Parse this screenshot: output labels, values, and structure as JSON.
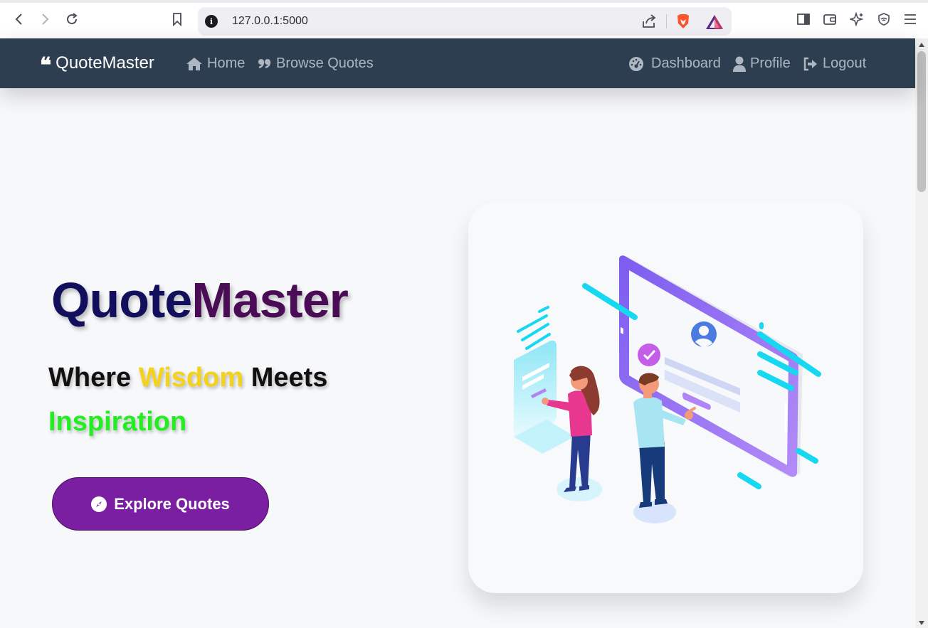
{
  "browser": {
    "url": "127.0.0.1:5000",
    "icons": [
      "back-icon",
      "forward-icon",
      "reload-icon",
      "bookmark-icon",
      "site-info-icon",
      "share-icon",
      "brave-shields-icon",
      "brave-rewards-icon",
      "sidebar-icon",
      "wallet-icon",
      "leo-ai-icon",
      "vpn-icon",
      "menu-icon"
    ],
    "info_glyph": "i"
  },
  "navbar": {
    "brand": "QuoteMaster",
    "brand_icon": "quote-left-icon",
    "links": [
      {
        "label": "Home",
        "icon": "home-icon"
      },
      {
        "label": "Browse Quotes",
        "icon": "quote-right-icon"
      },
      {
        "label": "Dashboard",
        "icon": "dashboard-icon"
      },
      {
        "label": "Profile",
        "icon": "user-icon"
      },
      {
        "label": "Logout",
        "icon": "logout-icon"
      }
    ],
    "colors": {
      "background": "#2c3e50",
      "link": "#aeb7c1",
      "brand": "#ffffff"
    }
  },
  "hero": {
    "title_part1": "Quote",
    "title_part2": "Master",
    "tagline_part1": "Where ",
    "tagline_highlight": "Wisdom",
    "tagline_part2": " Meets",
    "tagline_line2": "Inspiration",
    "cta_label": "Explore Quotes",
    "cta_icon": "compass-icon",
    "colors": {
      "title1": "#12105c",
      "title2": "#4a0d55",
      "wisdom": "#f4d21a",
      "inspiration": "#22ee22",
      "cta": "#7b1fa2"
    }
  },
  "illustration": {
    "name": "collaboration-illustration"
  }
}
